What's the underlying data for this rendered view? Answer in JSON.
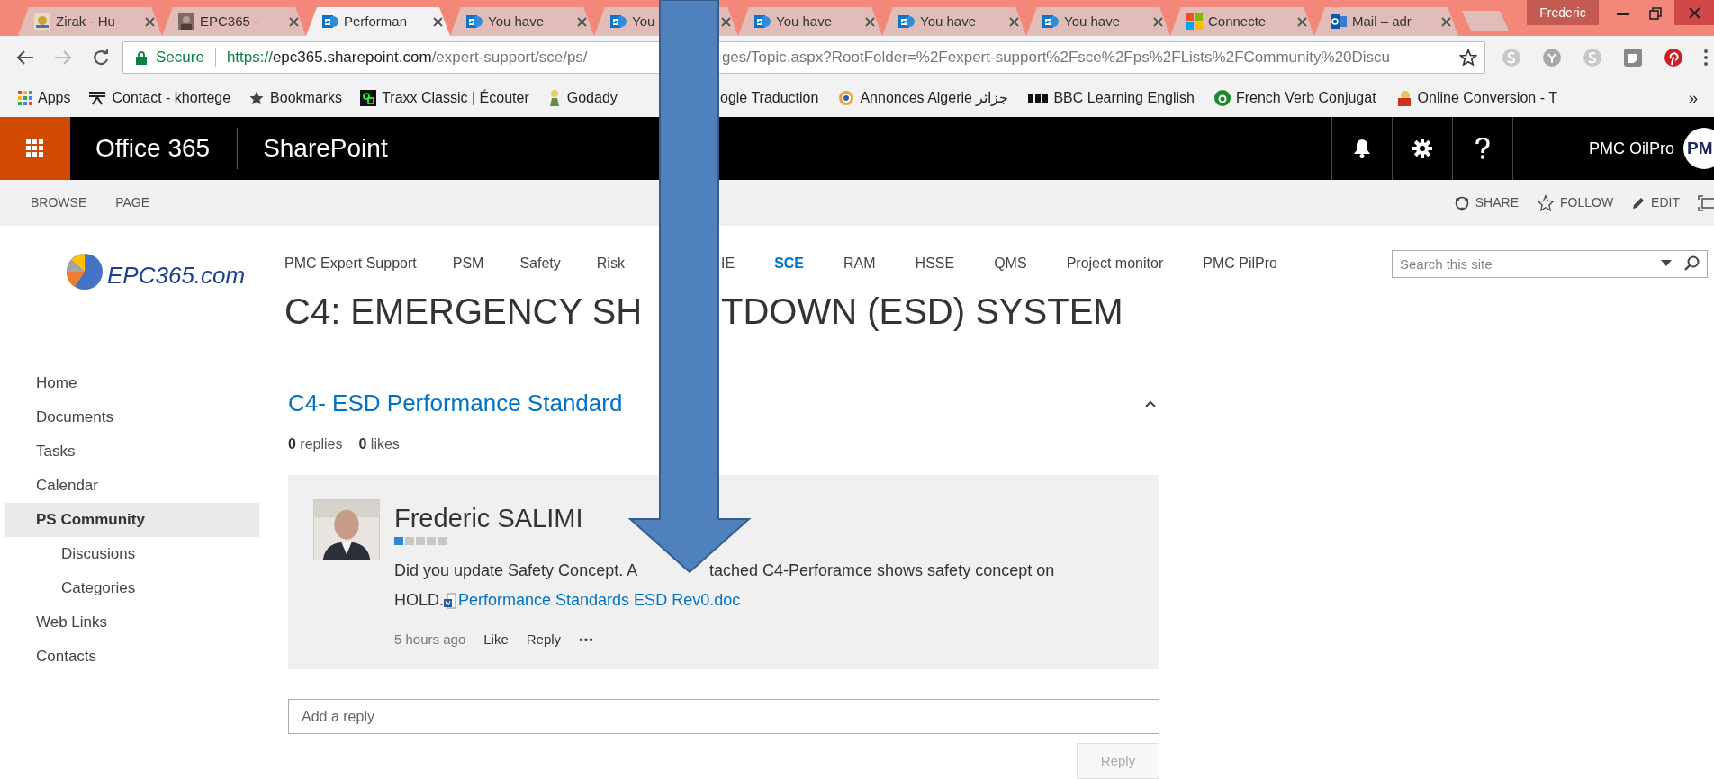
{
  "browser": {
    "tabs": [
      {
        "title": "Zirak - Hu",
        "kind": "thumb",
        "selected": false
      },
      {
        "title": "EPC365 - ",
        "selected": false
      },
      {
        "title": "Performan",
        "kind": "site",
        "selected": true
      },
      {
        "title": "You have",
        "kind": "site",
        "selected": false
      },
      {
        "title": "You",
        "kind": "site",
        "selected": false
      },
      {
        "title": "You have",
        "kind": "site",
        "selected": false
      },
      {
        "title": "You have",
        "kind": "site",
        "selected": false
      },
      {
        "title": "You have",
        "kind": "site",
        "selected": false
      },
      {
        "title": "Connecte",
        "kind": "windows",
        "selected": false
      },
      {
        "title": "Mail – adr",
        "kind": "mail",
        "selected": false
      }
    ],
    "profile": "Frederic",
    "secure_label": "Secure",
    "url_before_arrow": [
      {
        "text": "https://",
        "kind": "scheme"
      },
      {
        "text": "epc365.sharepoint.com",
        "kind": "host"
      },
      {
        "text": "/expert-support/sce/ps/",
        "kind": "path"
      }
    ],
    "url_after_arrow": "ges/Topic.aspx?RootFolder=%2Fexpert-support%2Fsce%2Fps%2FLists%2FCommunity%20Discu",
    "bookmarks_before_arrow": [
      {
        "label": "Apps",
        "kind": "apps"
      },
      {
        "label": "Contact - khortege",
        "kind": "contact"
      },
      {
        "label": "Bookmarks",
        "kind": "star"
      },
      {
        "label": "Traxx Classic | Écouter",
        "kind": "traxx"
      },
      {
        "label": "Godady",
        "kind": "figure"
      }
    ],
    "bookmarks_after_arrow": [
      {
        "label": "ogle Traduction",
        "kind": "none"
      },
      {
        "label": "Annonces Algerie جزائر",
        "kind": "eye"
      },
      {
        "label": "BBC Learning English",
        "kind": "bbc"
      },
      {
        "label": "French Verb Conjugat",
        "kind": "circle-a"
      },
      {
        "label": "Online Conversion - T",
        "kind": "person"
      }
    ],
    "bookmarks_more": "»"
  },
  "suite": {
    "brand": "Office 365",
    "app": "SharePoint",
    "user": "PMC OilPro",
    "initials": "PM"
  },
  "ribbon": {
    "tabs": [
      "BROWSE",
      "PAGE"
    ],
    "actions": [
      {
        "label": "SHARE",
        "kind": "share"
      },
      {
        "label": "FOLLOW",
        "kind": "follow"
      },
      {
        "label": "EDIT",
        "kind": "edit"
      }
    ]
  },
  "site": {
    "logo_text": "EPC365.com",
    "nav_before_arrow": [
      {
        "label": "PMC Expert Support",
        "selected": false
      },
      {
        "label": "PSM",
        "selected": false
      },
      {
        "label": "Safety",
        "selected": false
      },
      {
        "label": "Risk",
        "selected": false
      }
    ],
    "nav_after_arrow": [
      {
        "label": "IE",
        "selected": false
      },
      {
        "label": "SCE",
        "selected": true
      },
      {
        "label": "RAM",
        "selected": false
      },
      {
        "label": "HSSE",
        "selected": false
      },
      {
        "label": "QMS",
        "selected": false
      },
      {
        "label": "Project monitor",
        "selected": false
      },
      {
        "label": "PMC PilPro",
        "selected": false
      }
    ],
    "search": {
      "placeholder": "Search this site"
    },
    "title_before_arrow": "C4: EMERGENCY SH",
    "title_after_arrow": "TDOWN (ESD) SYSTEM"
  },
  "quick_launch": [
    {
      "label": "Home",
      "selected": false
    },
    {
      "label": "Documents",
      "selected": false
    },
    {
      "label": "Tasks",
      "selected": false
    },
    {
      "label": "Calendar",
      "selected": false
    },
    {
      "label": "PS Community",
      "selected": true,
      "children": [
        {
          "label": "Discusions",
          "selected": false
        },
        {
          "label": "Categories",
          "selected": false
        }
      ]
    },
    {
      "label": "Web Links",
      "selected": false
    },
    {
      "label": "Contacts",
      "selected": false
    }
  ],
  "discussion": {
    "subject": "C4- ESD Performance Standard",
    "expanded": true,
    "replies_count": "0",
    "replies_label": "replies",
    "likes_count": "0",
    "likes_label": "likes",
    "post": {
      "author": "Frederic SALIMI",
      "stars": 1,
      "message_before_arrow": "Did you update Safety Concept. A",
      "message_after_arrow": "tached C4-Perforamce shows safety concept on",
      "message_line2": "HOLD.",
      "attachment": "Performance Standards ESD Rev0.doc",
      "time": "5 hours ago",
      "actions": [
        "Like",
        "Reply"
      ],
      "more": "•••"
    },
    "reply_box": {
      "placeholder": "Add a reply"
    },
    "reply_button": {
      "label": "Reply",
      "disabled": true
    }
  }
}
